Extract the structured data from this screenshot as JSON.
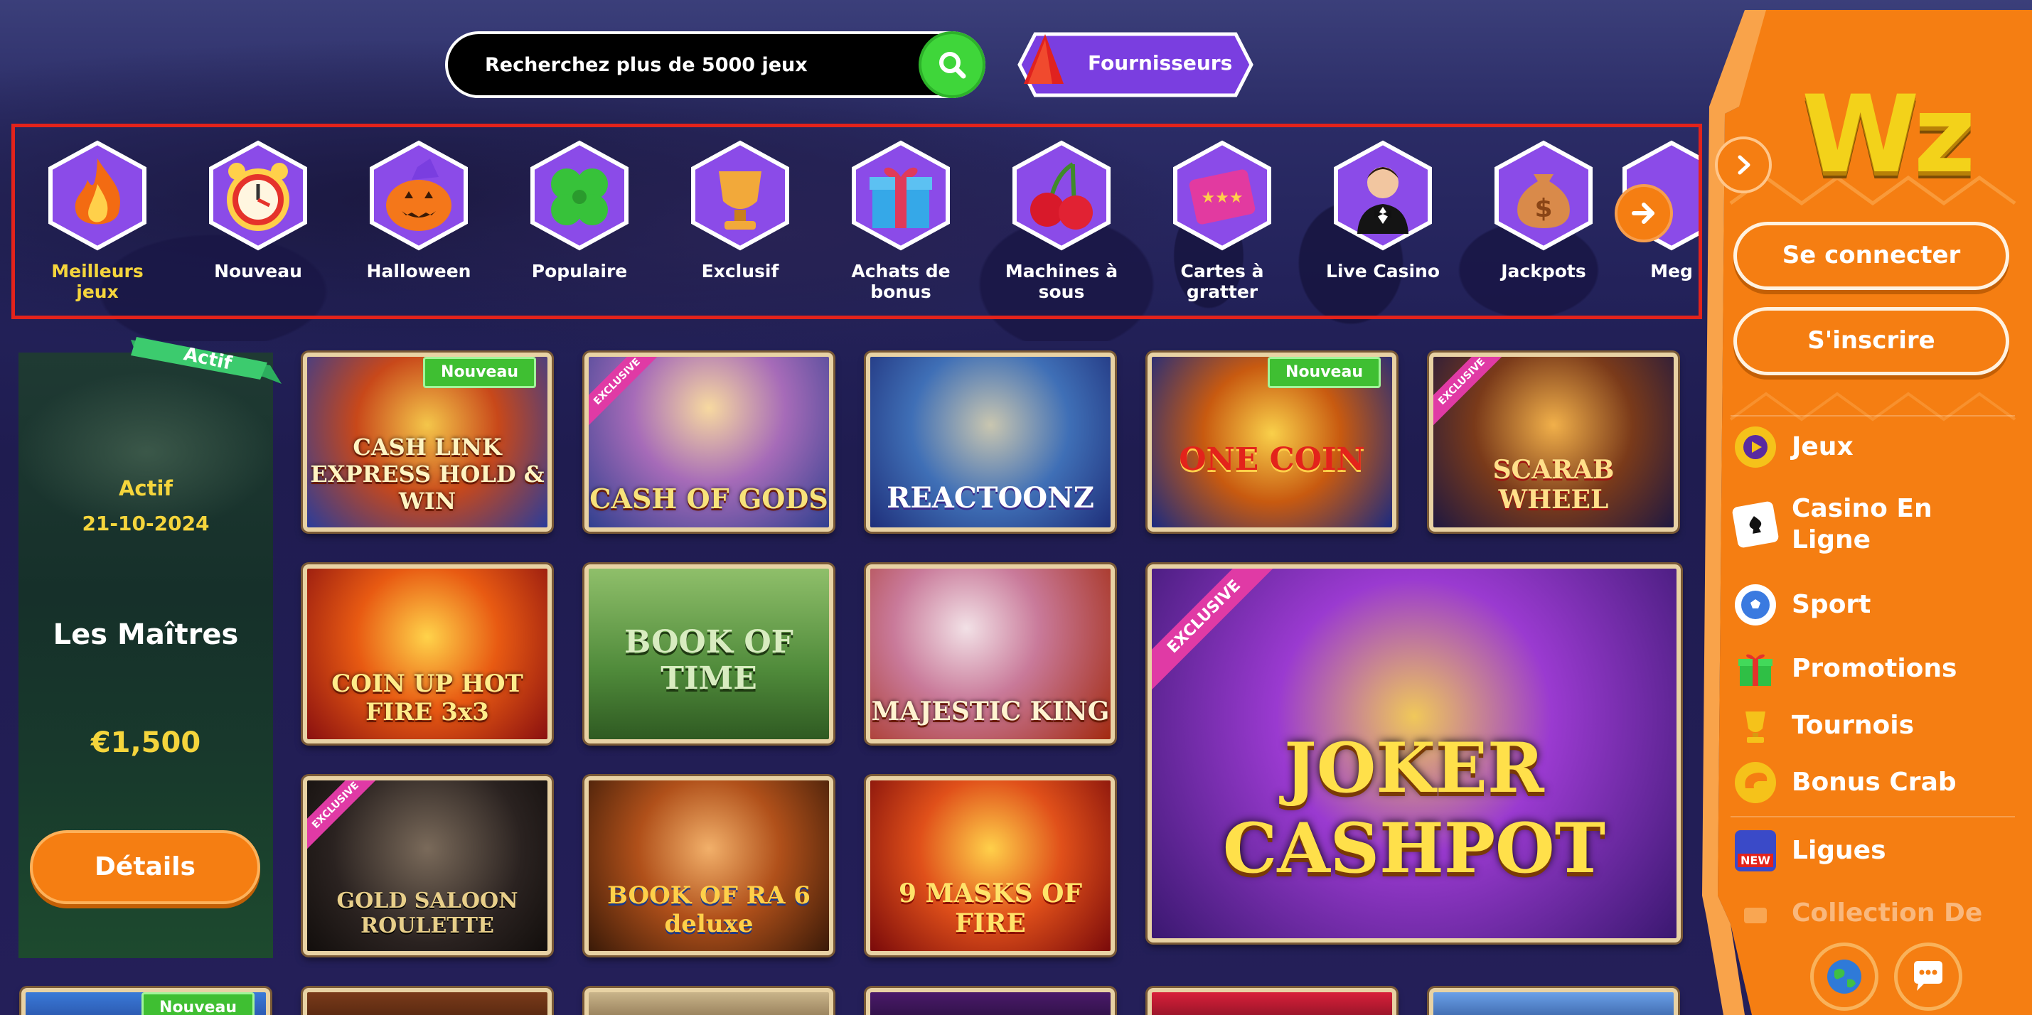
{
  "search": {
    "placeholder": "Recherchez plus de 5000 jeux"
  },
  "providers": {
    "label": "Fournisseurs"
  },
  "categories": [
    {
      "label": "Meilleurs jeux",
      "icon": "fire-icon",
      "active": true
    },
    {
      "label": "Nouveau",
      "icon": "alarm-clock-icon"
    },
    {
      "label": "Halloween",
      "icon": "pumpkin-icon"
    },
    {
      "label": "Populaire",
      "icon": "clover-icon"
    },
    {
      "label": "Exclusif",
      "icon": "trophy-cup-icon"
    },
    {
      "label": "Achats de bonus",
      "icon": "gift-icon"
    },
    {
      "label": "Machines à sous",
      "icon": "cherries-icon"
    },
    {
      "label": "Cartes à gratter",
      "icon": "scratch-card-icon"
    },
    {
      "label": "Live Casino",
      "icon": "dealer-icon"
    },
    {
      "label": "Jackpots",
      "icon": "money-bag-icon"
    },
    {
      "label": "Meg",
      "icon": "partial-icon"
    }
  ],
  "promo": {
    "ribbon": "Actif",
    "status": "Actif",
    "date": "21-10-2024",
    "title": "Les Maîtres",
    "amount": "€1,500",
    "button": "Détails"
  },
  "games": [
    {
      "name": "CASH LINK EXPRESS HOLD & WIN",
      "badge": "Nouveau"
    },
    {
      "name": "CASH OF GODS",
      "badge": "EXCLUSIVE"
    },
    {
      "name": "REACTOONZ"
    },
    {
      "name": "ONE COIN",
      "badge": "Nouveau"
    },
    {
      "name": "SCARAB WHEEL",
      "badge": "EXCLUSIVE"
    },
    {
      "name": "COIN UP HOT FIRE 3x3"
    },
    {
      "name": "BOOK OF TIME"
    },
    {
      "name": "MAJESTIC KING"
    },
    {
      "name": "JOKER CASHPOT",
      "badge": "EXCLUSIVE"
    },
    {
      "name": "GOLD SALOON ROULETTE",
      "badge": "EXCLUSIVE"
    },
    {
      "name": "BOOK OF RA 6 deluxe"
    },
    {
      "name": "9 MASKS OF FIRE"
    },
    {
      "name": "",
      "badge": "Nouveau"
    }
  ],
  "sidebar": {
    "logo": "Wz",
    "login": "Se connecter",
    "register": "S'inscrire",
    "nav": [
      {
        "label": "Jeux",
        "icon": "play-icon"
      },
      {
        "label": "Casino En Ligne",
        "icon": "playing-card-icon"
      },
      {
        "label": "Sport",
        "icon": "soccer-ball-icon"
      },
      {
        "label": "Promotions",
        "icon": "gift-icon"
      },
      {
        "label": "Tournois",
        "icon": "trophy-icon"
      },
      {
        "label": "Bonus Crab",
        "icon": "crab-claw-icon"
      },
      {
        "label": "Ligues",
        "icon": "league-new-icon",
        "tag": "NEW"
      },
      {
        "label": "Collection De",
        "icon": "collection-icon"
      }
    ]
  },
  "colors": {
    "accent": "#f57e12",
    "highlight": "#f5d53c",
    "success": "#3fd63a",
    "frame": "#e3231b",
    "purple": "#7a3ee0"
  }
}
